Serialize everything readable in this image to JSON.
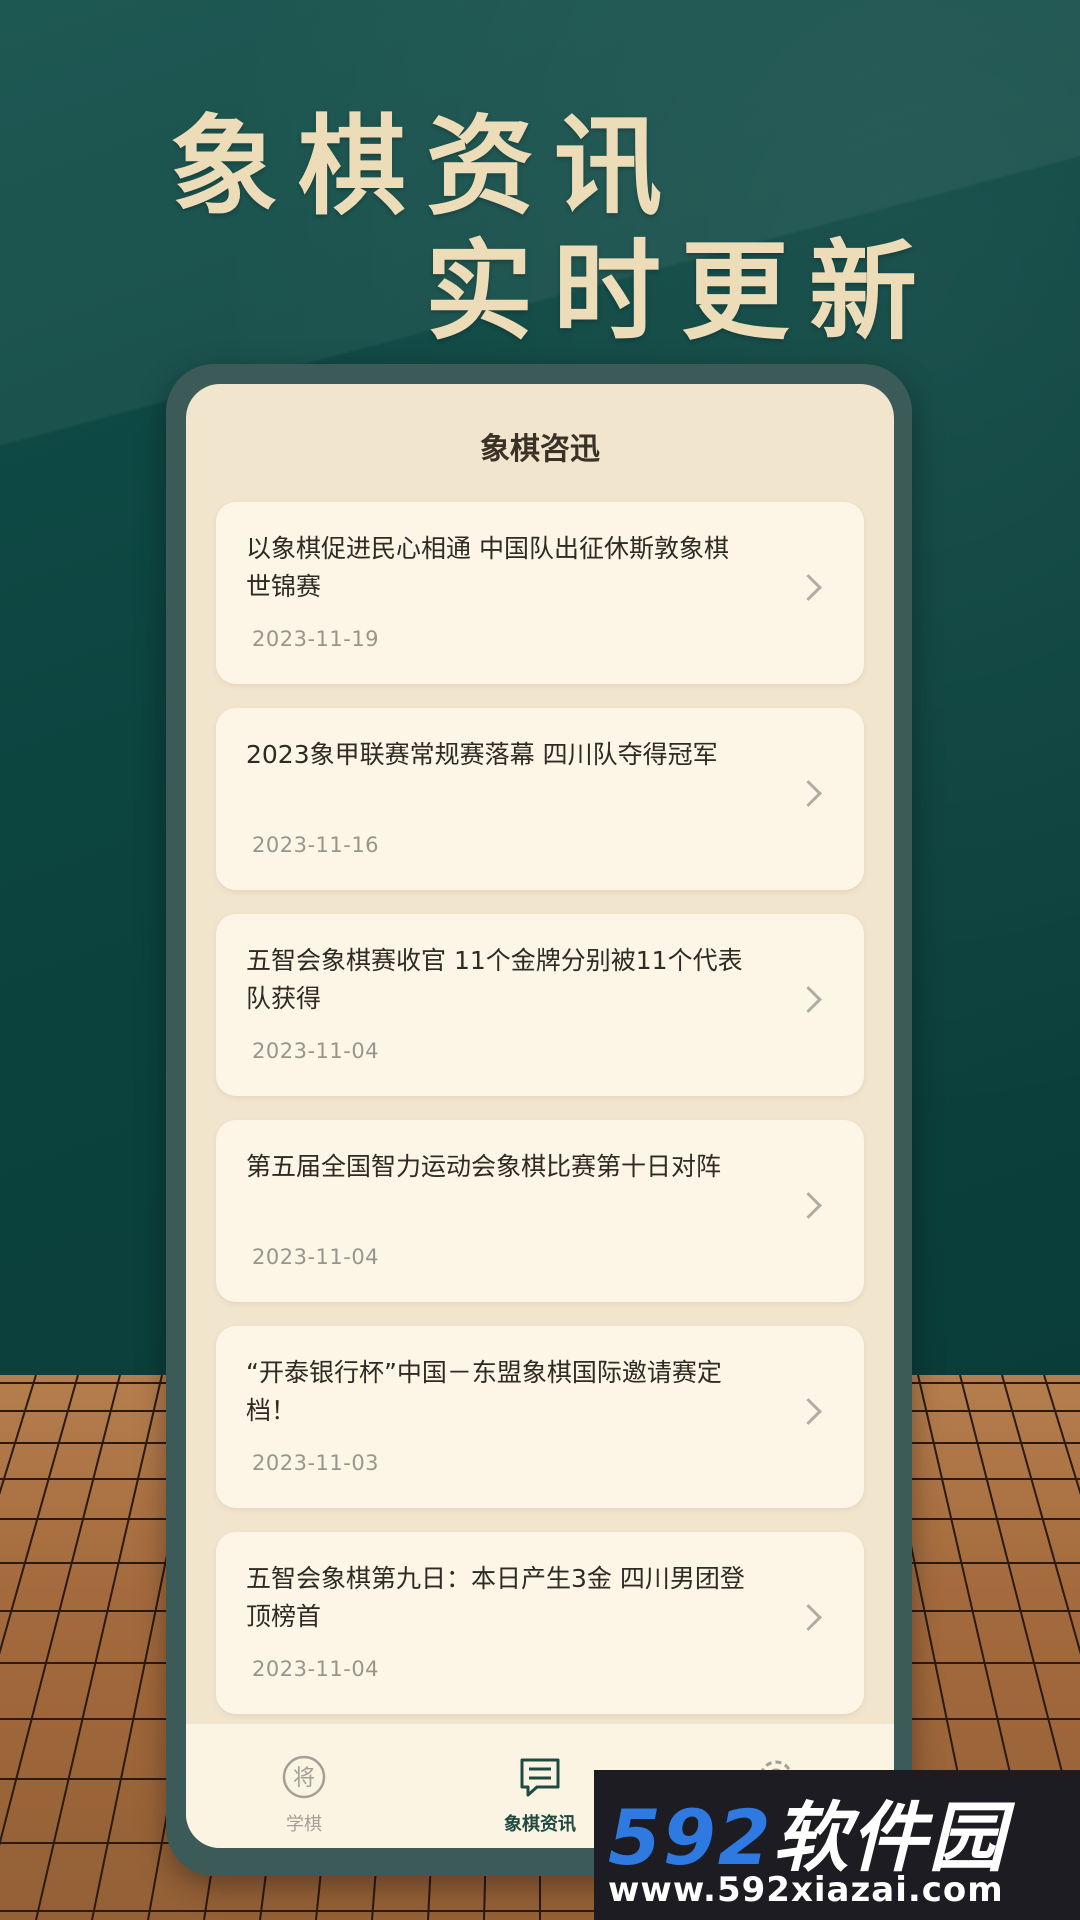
{
  "headline": {
    "line1": "象棋资讯",
    "line2": "实时更新"
  },
  "screen": {
    "title": "象棋咨迅"
  },
  "news": [
    {
      "title": "以象棋促进民心相通 中国队出征休斯敦象棋世锦赛",
      "date": "2023-11-19"
    },
    {
      "title": "2023象甲联赛常规赛落幕 四川队夺得冠军",
      "date": "2023-11-16"
    },
    {
      "title": "五智会象棋赛收官 11个金牌分别被11个代表队获得",
      "date": "2023-11-04"
    },
    {
      "title": "第五届全国智力运动会象棋比赛第十日对阵",
      "date": "2023-11-04"
    },
    {
      "title": "“开泰银行杯”中国－东盟象棋国际邀请赛定档！",
      "date": "2023-11-03"
    },
    {
      "title": "五智会象棋第九日：本日产生3金 四川男团登顶榜首",
      "date": "2023-11-04"
    }
  ],
  "tabs": [
    {
      "label": "学棋",
      "icon": "jiang-piece-icon",
      "active": false
    },
    {
      "label": "象棋资讯",
      "icon": "news-chat-icon",
      "active": true
    },
    {
      "label": "",
      "icon": "gear-icon",
      "active": false
    }
  ],
  "watermark": {
    "brand_num": "592",
    "brand_text": "软件园",
    "url": "www.592xiazai.com"
  },
  "colors": {
    "background": "#0d4743",
    "phone_frame": "#3c5b58",
    "screen": "#f2e5ce",
    "card": "#fdf5e6",
    "headline": "#ecdcb8",
    "active_tab": "#1f4a44"
  }
}
